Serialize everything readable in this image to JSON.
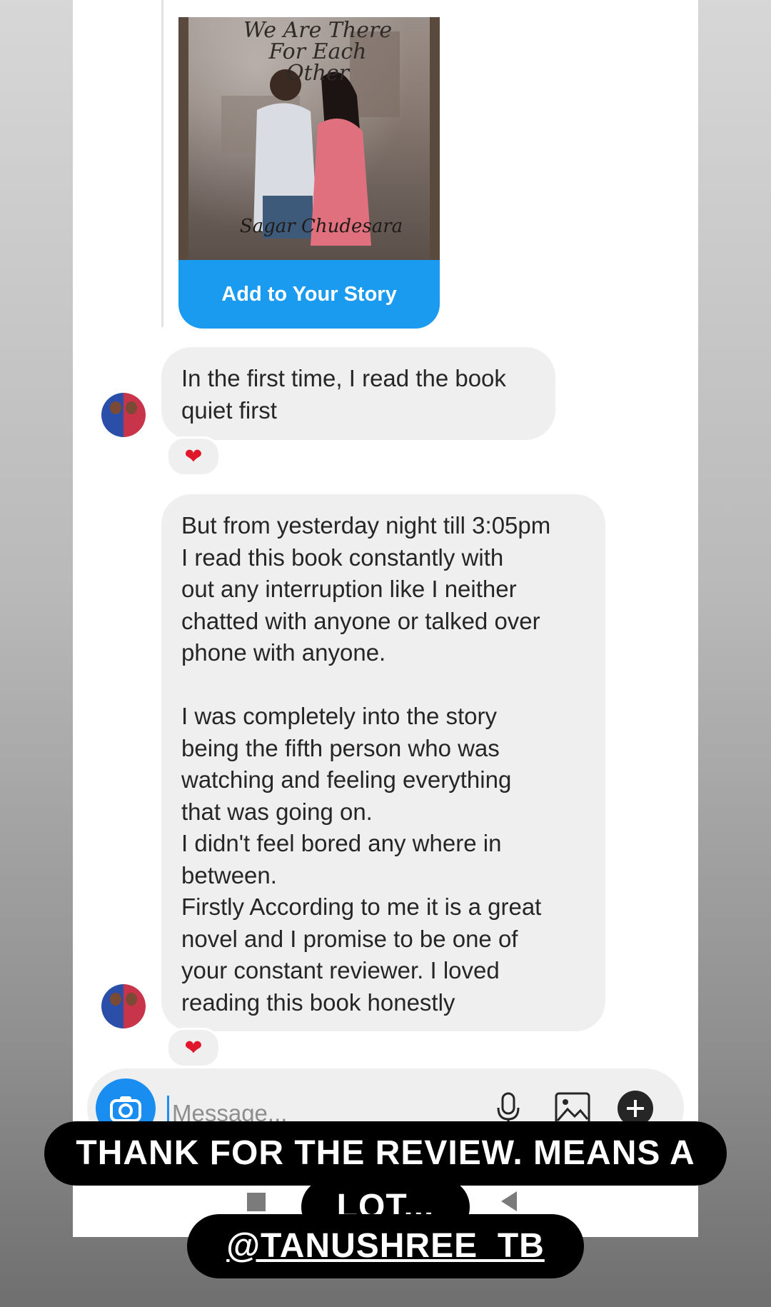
{
  "story_card": {
    "cover_title": "We Are There For Each Other",
    "cover_author": "Sagar Chudesara",
    "button_label": "Add to Your Story"
  },
  "messages": [
    {
      "text": "In the first time, I read the book\nquiet first",
      "reaction": "❤"
    },
    {
      "text": "But from yesterday night till 3:05pm\nI read this book constantly with\nout any interruption like I neither\nchatted with anyone or talked over\nphone with anyone.\n\nI was completely into the story\nbeing the fifth person who was\nwatching and feeling everything\nthat was going on.\nI didn't feel bored any where in\nbetween.\nFirstly According to me it is a great\nnovel and I promise to be one of\nyour constant reviewer. I loved\nreading this book honestly",
      "reaction": "❤"
    }
  ],
  "composer": {
    "placeholder": "Message..."
  },
  "caption": {
    "line1": "THANK FOR THE REVIEW. MEANS A",
    "line2": "LOT...",
    "mention": "@TANUSHREE_TB"
  },
  "colors": {
    "accent": "#1a9bf0",
    "bubble": "#efefef",
    "heart": "#e0172b"
  }
}
